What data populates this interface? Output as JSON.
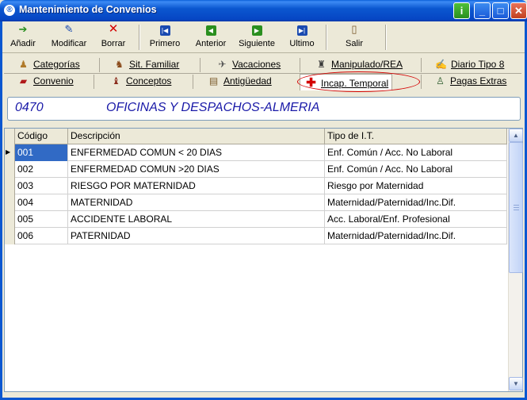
{
  "window": {
    "title": "Mantenimiento de Convenios"
  },
  "toolbar": {
    "buttons": [
      {
        "label": "Añadir",
        "icon": "add-icon"
      },
      {
        "label": "Modificar",
        "icon": "edit-icon"
      },
      {
        "label": "Borrar",
        "icon": "delete-icon"
      },
      {
        "label": "Primero",
        "icon": "first-record-icon"
      },
      {
        "label": "Anterior",
        "icon": "previous-record-icon"
      },
      {
        "label": "Siguiente",
        "icon": "next-record-icon"
      },
      {
        "label": "Ultimo",
        "icon": "last-record-icon"
      },
      {
        "label": "Salir",
        "icon": "exit-icon"
      }
    ]
  },
  "tabs": {
    "top_row": [
      {
        "label": "Categorías",
        "icon": "worker-icon"
      },
      {
        "label": "Sit. Familiar",
        "icon": "family-icon"
      },
      {
        "label": "Vacaciones",
        "icon": "plane-icon"
      },
      {
        "label": "Manipulado/REA",
        "icon": "farmer-icon"
      },
      {
        "label": "Diario Tipo 8",
        "icon": "diary-icon"
      }
    ],
    "bottom_row": [
      {
        "label": "Convenio",
        "icon": "book-icon"
      },
      {
        "label": "Conceptos",
        "icon": "concepts-icon"
      },
      {
        "label": "Antigüedad",
        "icon": "seniority-icon"
      },
      {
        "label": "Incap. Temporal",
        "icon": "red-cross-icon",
        "active": true
      },
      {
        "label": "Pagas Extras",
        "icon": "money-bag-icon"
      }
    ]
  },
  "header": {
    "code": "0470",
    "name": "OFICINAS Y DESPACHOS-ALMERIA"
  },
  "grid": {
    "columns": [
      "Código",
      "Descripción",
      "Tipo de I.T."
    ],
    "rows": [
      {
        "codigo": "001",
        "descripcion": "ENFERMEDAD COMUN < 20 DIAS",
        "tipo": "Enf. Común / Acc. No Laboral"
      },
      {
        "codigo": "002",
        "descripcion": "ENFERMEDAD COMUN >20 DIAS",
        "tipo": "Enf. Común / Acc. No Laboral"
      },
      {
        "codigo": "003",
        "descripcion": "RIESGO POR MATERNIDAD",
        "tipo": "Riesgo por Maternidad"
      },
      {
        "codigo": "004",
        "descripcion": "MATERNIDAD",
        "tipo": "Maternidad/Paternidad/Inc.Dif."
      },
      {
        "codigo": "005",
        "descripcion": "ACCIDENTE LABORAL",
        "tipo": "Acc. Laboral/Enf. Profesional"
      },
      {
        "codigo": "006",
        "descripcion": "PATERNIDAD",
        "tipo": "Maternidad/Paternidad/Inc.Dif."
      }
    ]
  },
  "colors": {
    "titlebar": "#0b57d0",
    "selection": "#316ac5",
    "header_text": "#1a1aa8",
    "highlight_oval": "#d40000"
  }
}
